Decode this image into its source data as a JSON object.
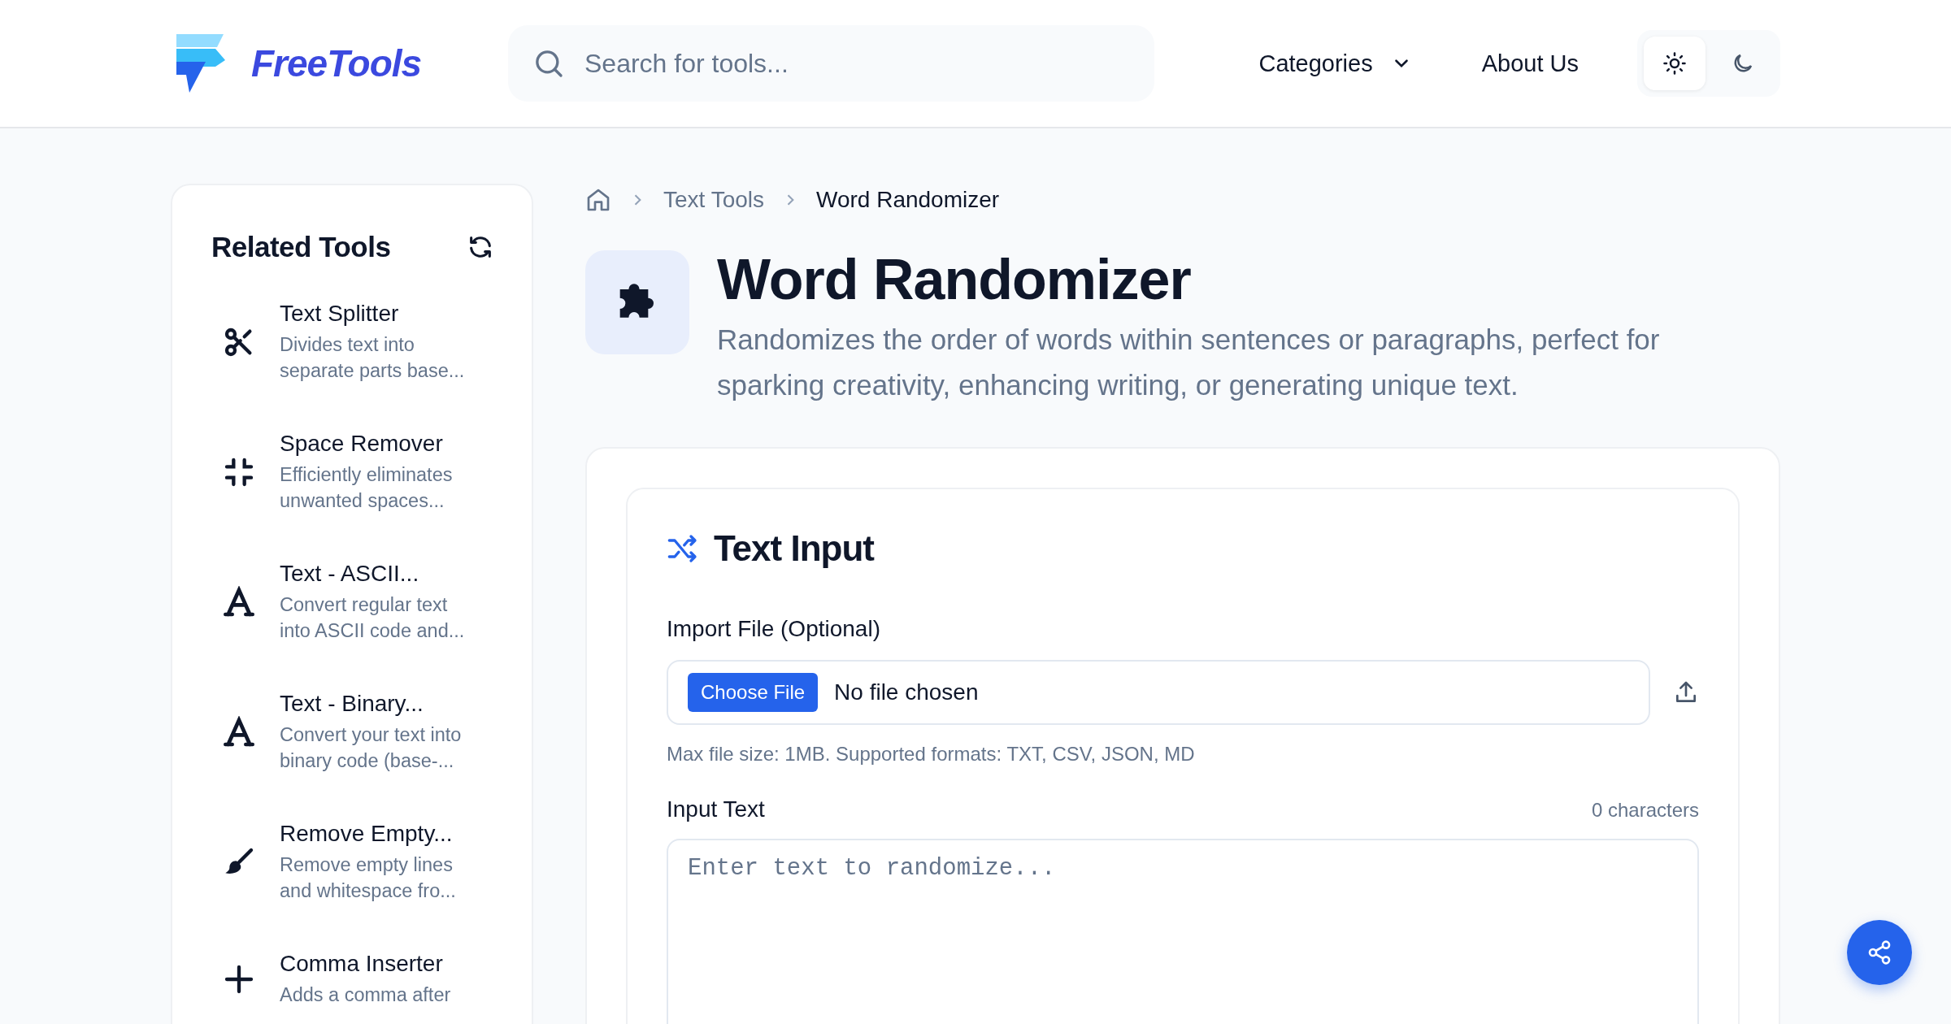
{
  "header": {
    "logo": "FreeTools",
    "search": {
      "placeholder": "Search for tools..."
    },
    "nav": [
      {
        "label": "Categories",
        "kind": "dropdown"
      },
      {
        "label": "About Us",
        "kind": "link"
      }
    ],
    "theme": [
      {
        "kind": "light",
        "selected": true
      },
      {
        "kind": "dark",
        "selected": false
      }
    ]
  },
  "sidebar": {
    "title": "Related Tools",
    "items": [
      {
        "kind": "scissors",
        "title": "Text Splitter",
        "description": "Divides text into",
        "description_2": "separate parts base..."
      },
      {
        "kind": "compress",
        "title": "Space Remover",
        "description": "Efficiently eliminates",
        "description_2": "unwanted spaces..."
      },
      {
        "kind": "letter",
        "title": "Text - ASCII...",
        "description": "Convert regular text",
        "description_2": "into ASCII code and..."
      },
      {
        "kind": "letter",
        "title": "Text - Binary...",
        "description": "Convert your text into",
        "description_2": "binary code (base-..."
      },
      {
        "kind": "brush",
        "title": "Remove Empty...",
        "description": "Remove empty lines",
        "description_2": "and whitespace fro..."
      },
      {
        "kind": "plus",
        "title": "Comma Inserter",
        "description": "Adds a comma after"
      }
    ]
  },
  "breadcrumb": [
    {
      "label": "Text Tools"
    },
    {
      "label": "Word Randomizer"
    }
  ],
  "tool": {
    "title": "Word Randomizer",
    "description": "Randomizes the order of words within sentences or paragraphs, perfect for sparking creativity, enhancing writing, or generating unique text."
  },
  "input_card": {
    "title": "Text Input",
    "import_label": "Import File (Optional)",
    "file_button": "Choose File",
    "file_status": "No file chosen",
    "hint": "Max file size: 1MB. Supported formats: TXT, CSV, JSON, MD",
    "input_label": "Input Text",
    "count": "0 characters",
    "placeholder": "Enter text to randomize..."
  }
}
